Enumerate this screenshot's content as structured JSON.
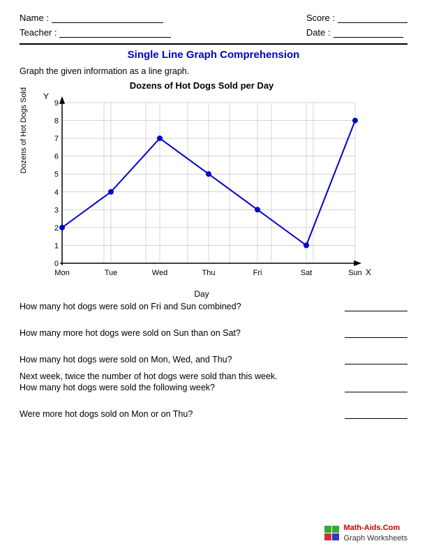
{
  "header": {
    "name_label": "Name :",
    "teacher_label": "Teacher :",
    "score_label": "Score :",
    "date_label": "Date :"
  },
  "title": "Single Line Graph Comprehension",
  "instruction": "Graph the given information as a line graph.",
  "graph": {
    "title": "Dozens of Hot Dogs Sold per Day",
    "y_axis_label": "Dozens of Hot Dogs Sold",
    "x_axis_label": "Day",
    "y_axis_label_top": "Y",
    "x_axis_label_right": "X",
    "x_labels": [
      "Mon",
      "Tue",
      "Wed",
      "Thu",
      "Fri",
      "Sat",
      "Sun"
    ],
    "y_values": [
      0,
      1,
      2,
      3,
      4,
      5,
      6,
      7,
      8,
      9
    ],
    "data_points": [
      {
        "day": "Mon",
        "value": 2
      },
      {
        "day": "Tue",
        "value": 4
      },
      {
        "day": "Wed",
        "value": 7
      },
      {
        "day": "Thu",
        "value": 5
      },
      {
        "day": "Fri",
        "value": 3
      },
      {
        "day": "Sat",
        "value": 1
      },
      {
        "day": "Sun",
        "value": 8
      }
    ]
  },
  "questions": [
    {
      "id": "q1",
      "text": "How many hot dogs were sold on Fri and Sun combined?"
    },
    {
      "id": "q2",
      "text": "How many more hot dogs were sold on Sun than on Sat?"
    },
    {
      "id": "q3",
      "text": "How many hot dogs were sold on Mon, Wed, and Thu?"
    },
    {
      "id": "q4a",
      "text": "Next week, twice the number of hot dogs were sold than this week."
    },
    {
      "id": "q4b",
      "text": "How many hot dogs were sold the following week?"
    },
    {
      "id": "q5",
      "text": "Were more hot dogs sold on Mon or on Thu?"
    }
  ],
  "footer": {
    "site": "Math-Aids.Com",
    "subtitle": "Graph Worksheets"
  }
}
